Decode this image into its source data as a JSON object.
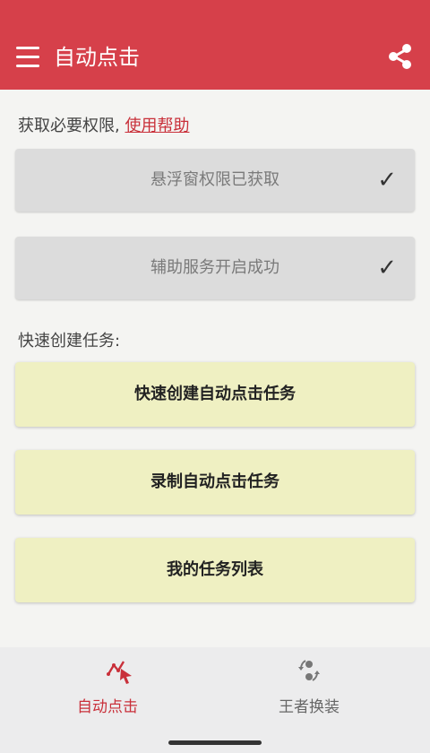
{
  "app_bar": {
    "title": "自动点击",
    "menu_icon": "menu-icon",
    "share_icon": "share-icon",
    "background": "#d6404a"
  },
  "permissions": {
    "prompt": "获取必要权限,",
    "help_link": "使用帮助",
    "items": [
      {
        "label": "悬浮窗权限已获取",
        "status": "✓"
      },
      {
        "label": "辅助服务开启成功",
        "status": "✓"
      }
    ]
  },
  "quick_tasks": {
    "header": "快速创建任务:",
    "buttons": [
      {
        "label": "快速创建自动点击任务"
      },
      {
        "label": "录制自动点击任务"
      },
      {
        "label": "我的任务列表"
      }
    ]
  },
  "bottom_nav": {
    "items": [
      {
        "label": "自动点击",
        "icon": "auto-click-icon",
        "active": true,
        "color": "#c9303a"
      },
      {
        "label": "王者换装",
        "icon": "swap-icon",
        "active": false,
        "color": "#666666"
      }
    ]
  }
}
